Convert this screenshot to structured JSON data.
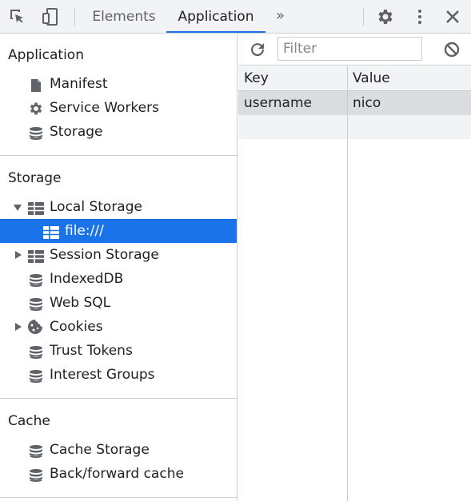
{
  "toolbar": {
    "tabs": [
      {
        "label": "Elements",
        "active": false
      },
      {
        "label": "Application",
        "active": true
      }
    ],
    "more_tabs": "»",
    "icons": [
      "inspect-element-icon",
      "device-toolbar-icon",
      "settings-gear-icon",
      "kebab-menu-icon",
      "close-icon"
    ]
  },
  "sidebar": {
    "sections": [
      {
        "title": "Application",
        "items": [
          {
            "label": "Manifest",
            "icon": "document-icon"
          },
          {
            "label": "Service Workers",
            "icon": "gear-icon"
          },
          {
            "label": "Storage",
            "icon": "database-icon"
          }
        ]
      },
      {
        "title": "Storage",
        "items": [
          {
            "label": "Local Storage",
            "icon": "grid-icon",
            "expanded": true
          },
          {
            "label": "file:///",
            "icon": "grid-icon",
            "selected": true
          },
          {
            "label": "Session Storage",
            "icon": "grid-icon",
            "expanded": false
          },
          {
            "label": "IndexedDB",
            "icon": "database-icon"
          },
          {
            "label": "Web SQL",
            "icon": "database-icon"
          },
          {
            "label": "Cookies",
            "icon": "cookie-icon",
            "expanded": false
          },
          {
            "label": "Trust Tokens",
            "icon": "database-icon"
          },
          {
            "label": "Interest Groups",
            "icon": "database-icon"
          }
        ]
      },
      {
        "title": "Cache",
        "items": [
          {
            "label": "Cache Storage",
            "icon": "database-icon"
          },
          {
            "label": "Back/forward cache",
            "icon": "database-icon"
          }
        ]
      }
    ]
  },
  "main": {
    "filter_placeholder": "Filter",
    "filter_value": "",
    "columns": [
      "Key",
      "Value"
    ],
    "rows": [
      {
        "key": "username",
        "value": "nico"
      }
    ]
  },
  "colors": {
    "accent": "#1a73e8",
    "toolbar_bg": "#f1f3f4",
    "border": "#cbcdd1",
    "selected_row_bg": "#dadce0",
    "icon": "#5f6368"
  }
}
